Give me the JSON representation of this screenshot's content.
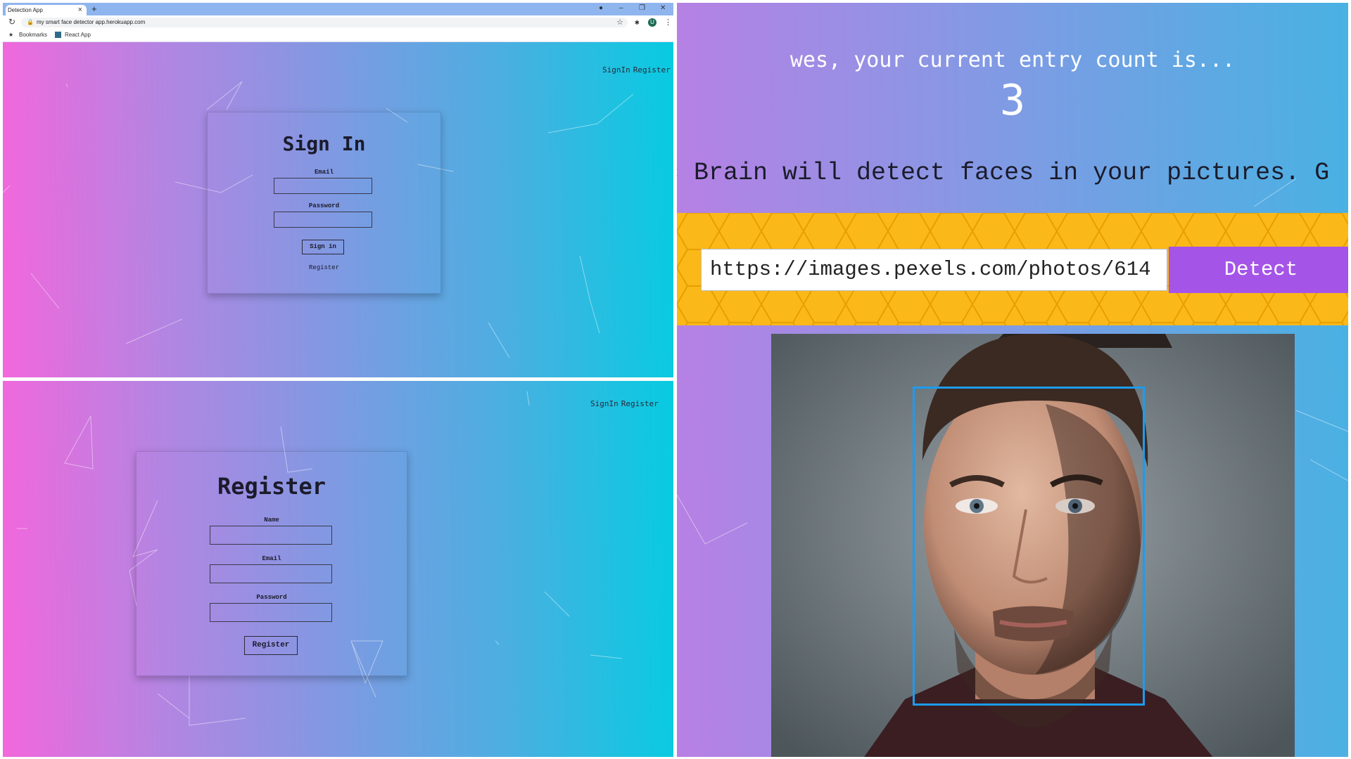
{
  "browser": {
    "tab_title": "Detection App",
    "tab_close": "×",
    "new_tab": "+",
    "url": "my smart face detector app.herokuapp.com",
    "bookmarks": [
      "Bookmarks",
      "React App"
    ],
    "avatar_initial": "U"
  },
  "nav": {
    "signin": "SignIn",
    "register": "Register"
  },
  "signin_form": {
    "title": "Sign In",
    "email_label": "Email",
    "password_label": "Password",
    "submit_label": "Sign in",
    "register_link": "Register"
  },
  "register_form": {
    "title": "Register",
    "name_label": "Name",
    "email_label": "Email",
    "password_label": "Password",
    "submit_label": "Register"
  },
  "detector": {
    "entry_text": "wes, your current entry count is...",
    "entry_count": "3",
    "intro_text": "c Brain will detect faces in your pictures. G",
    "url_value": "https://images.pexels.com/photos/614",
    "detect_label": "Detect"
  },
  "colors": {
    "gradient_start": "#f267dc",
    "gradient_end": "#07cbe1",
    "honeycomb": "#fbb819",
    "detect_button": "#a554e8",
    "face_box": "#1c9cf0"
  }
}
